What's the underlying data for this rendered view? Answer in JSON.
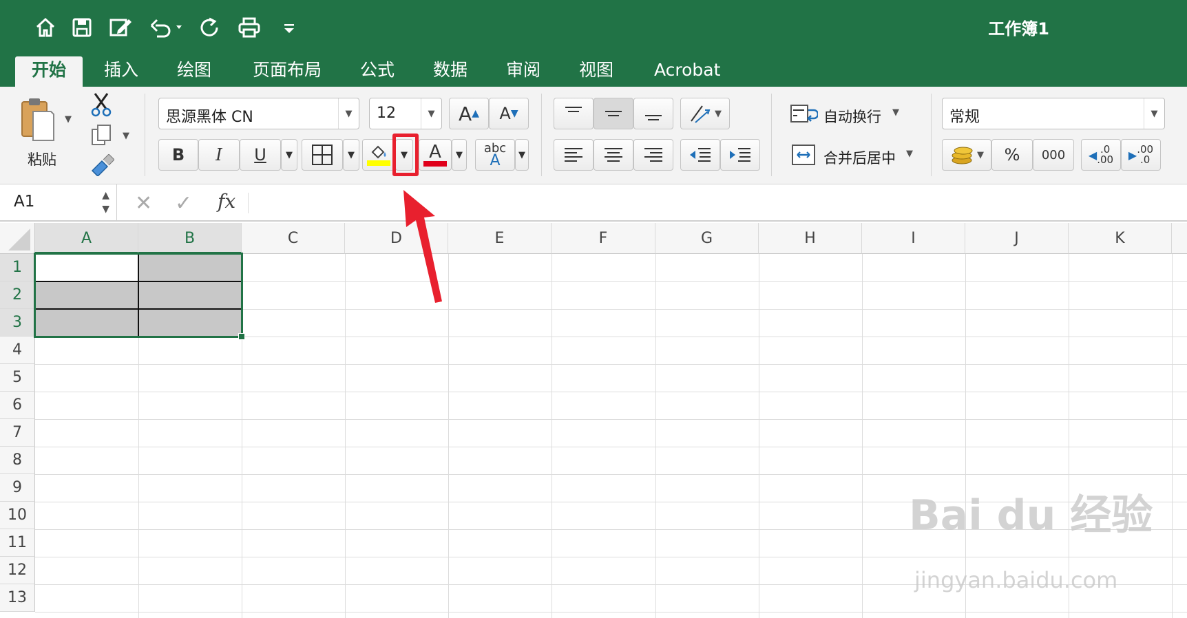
{
  "window": {
    "title": "工作簿1"
  },
  "quick_access": [
    "home-icon",
    "save-icon",
    "edit-icon",
    "undo-icon",
    "redo-icon",
    "print-icon",
    "customize-icon"
  ],
  "tabs": [
    "开始",
    "插入",
    "绘图",
    "页面布局",
    "公式",
    "数据",
    "审阅",
    "视图",
    "Acrobat"
  ],
  "active_tab": "开始",
  "ribbon": {
    "paste_label": "粘贴",
    "font_name": "思源黑体 CN",
    "font_size": "12",
    "bold": "B",
    "italic": "I",
    "underline": "U",
    "increase_font": "A",
    "decrease_font": "A",
    "font_color_letter": "A",
    "phonetic_top": "abc",
    "phonetic_bottom": "A",
    "wrap_text": "自动换行",
    "merge_center": "合并后居中",
    "number_format": "常规",
    "percent": "%",
    "comma": "000",
    "inc_decimal_top": ".0",
    "inc_decimal_bottom": ".00",
    "dec_decimal_top": ".00",
    "dec_decimal_bottom": ".0",
    "fill_color": "#FFFF00",
    "font_color": "#E0001B"
  },
  "formula_bar": {
    "name_box": "A1",
    "fx": "fx",
    "content": ""
  },
  "columns": [
    "A",
    "B",
    "C",
    "D",
    "E",
    "F",
    "G",
    "H",
    "I",
    "J",
    "K"
  ],
  "rows": [
    "1",
    "2",
    "3",
    "4",
    "5",
    "6",
    "7",
    "8",
    "9",
    "10",
    "11",
    "12",
    "13"
  ],
  "selection": "A1:B3",
  "watermark": {
    "main": "Bai du 经验",
    "sub": "jingyan.baidu.com"
  },
  "colors": {
    "accent": "#217346",
    "highlight": "#E8202E",
    "shaded_cell": "#C8C8C8"
  }
}
